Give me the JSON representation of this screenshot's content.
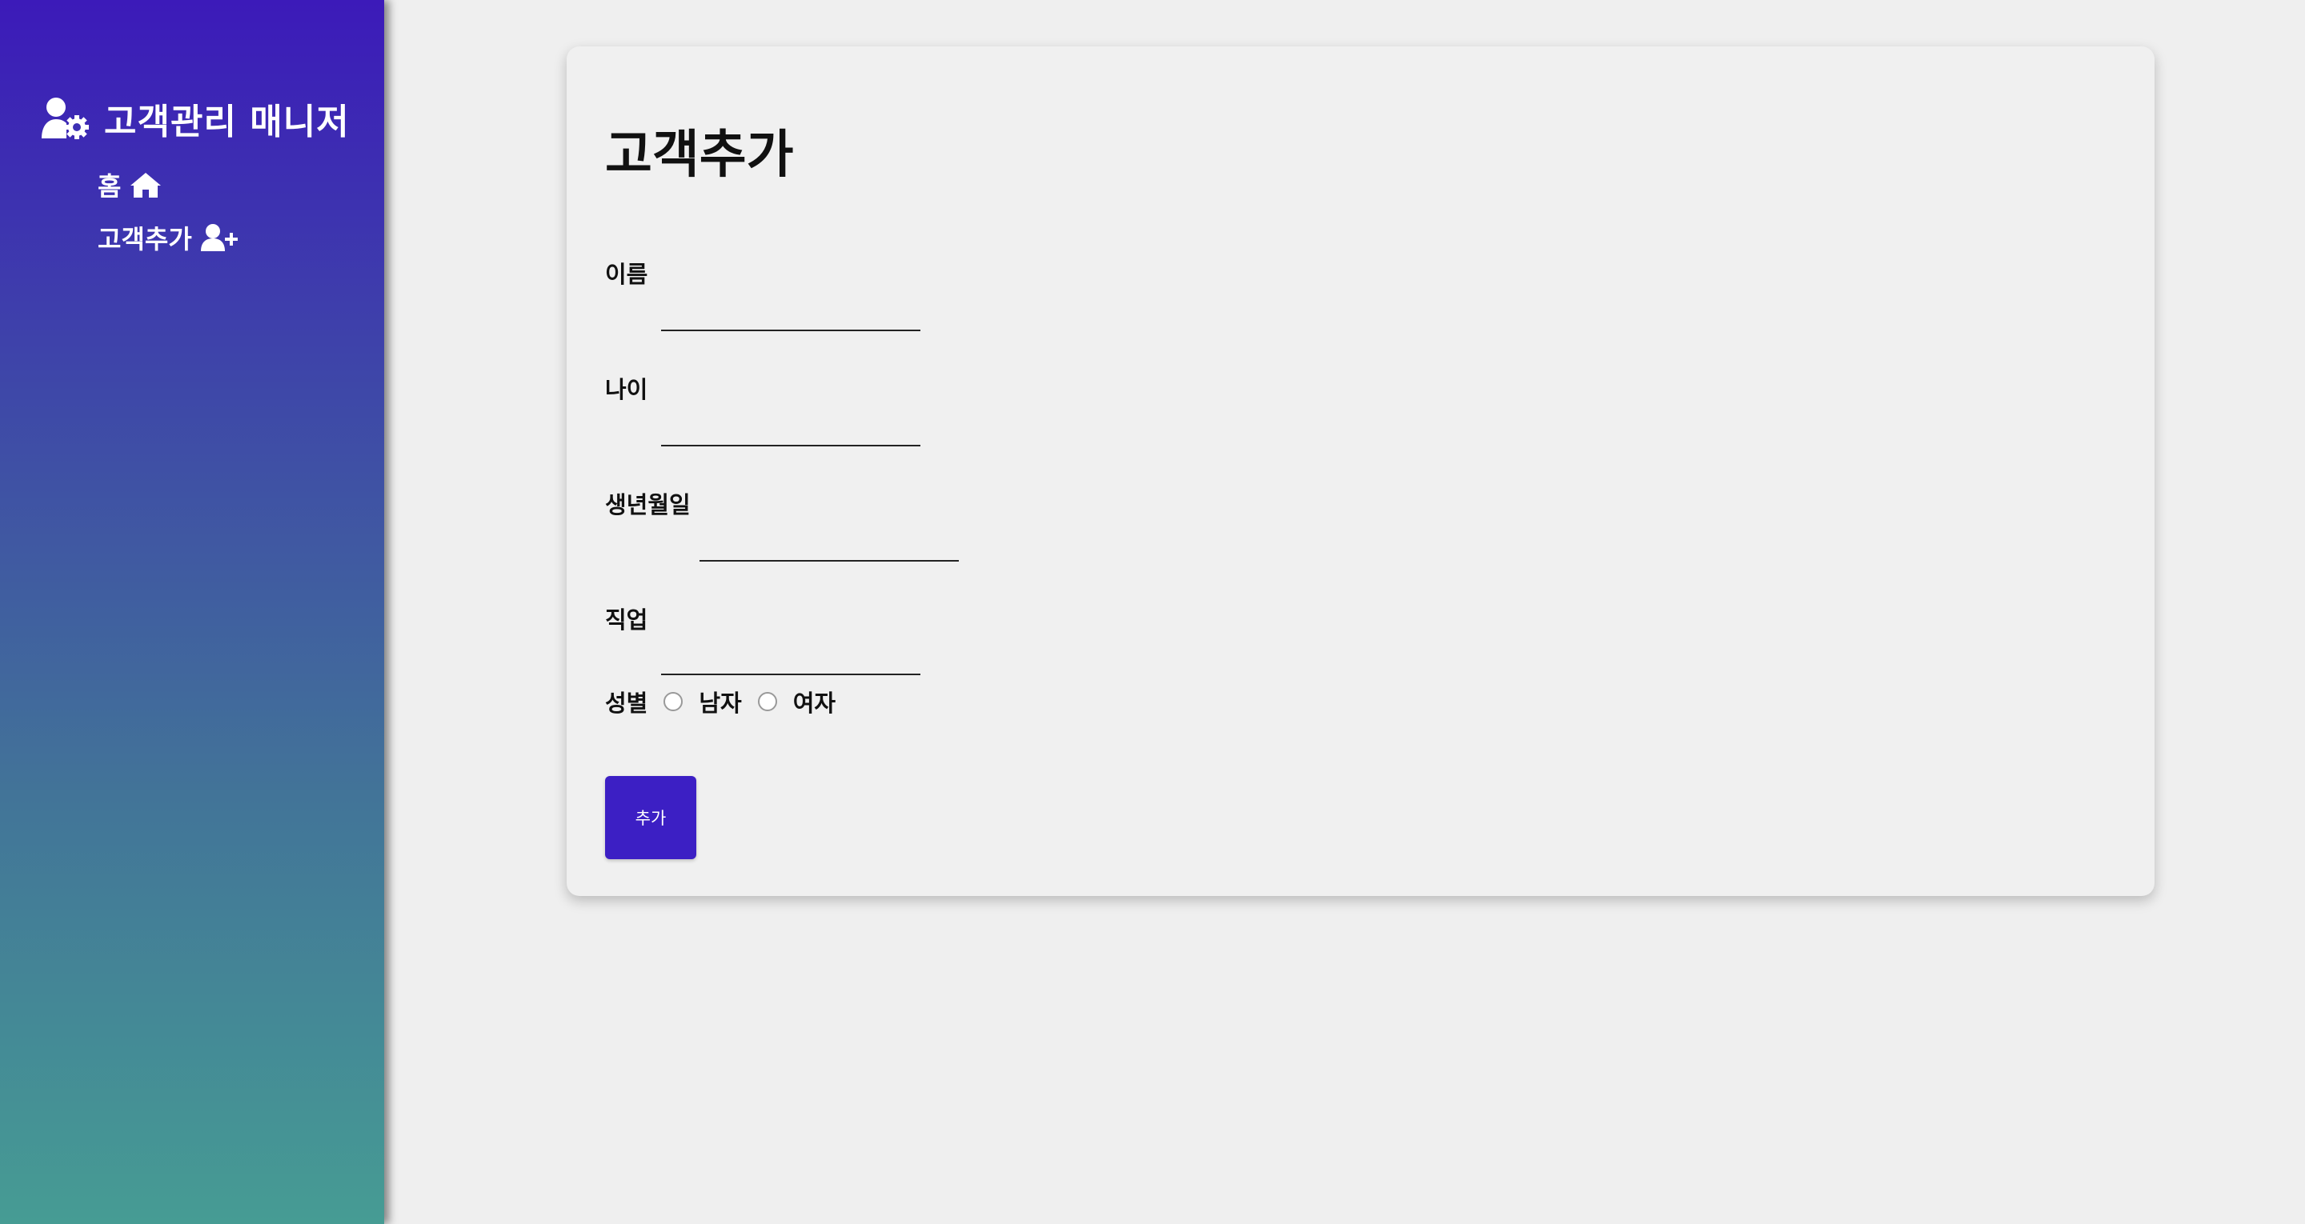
{
  "sidebar": {
    "brand_title": "고객관리 매니저",
    "brand_icon": "user-gear-icon",
    "nav": [
      {
        "label": "홈",
        "icon": "home-icon"
      },
      {
        "label": "고객추가",
        "icon": "user-plus-icon"
      }
    ],
    "gradient": [
      "#3c1ab9",
      "#469c94"
    ]
  },
  "form": {
    "title": "고객추가",
    "fields": [
      {
        "label": "이름",
        "value": ""
      },
      {
        "label": "나이",
        "value": ""
      },
      {
        "label": "생년월일",
        "value": ""
      },
      {
        "label": "직업",
        "value": ""
      }
    ],
    "gender": {
      "label": "성별",
      "options": [
        "남자",
        "여자"
      ]
    },
    "submit_label": "추가",
    "accent_color": "#3c1fc4"
  }
}
